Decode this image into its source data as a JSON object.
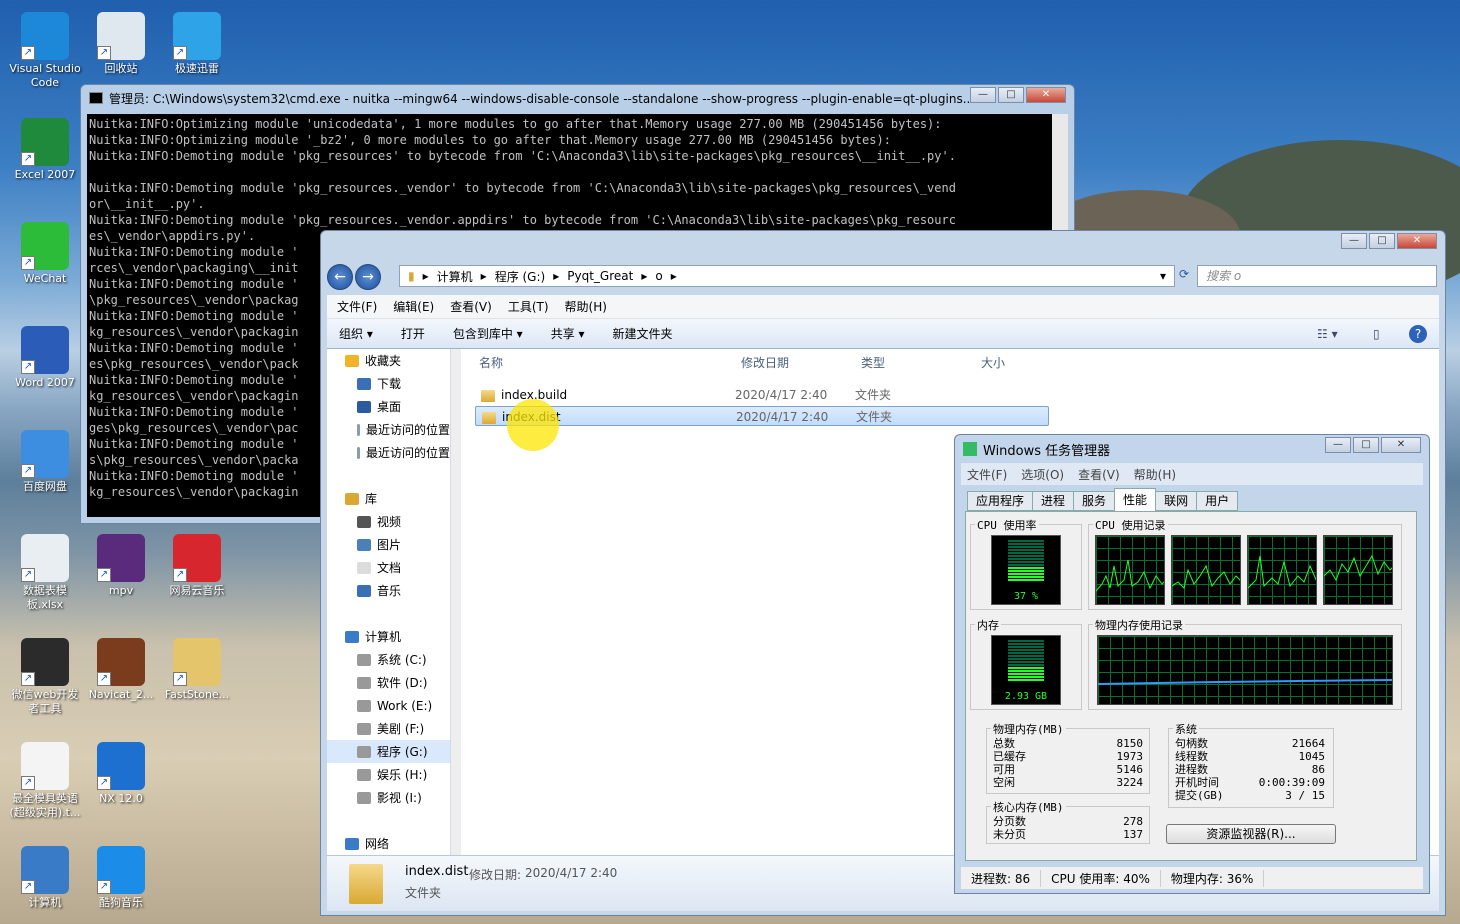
{
  "desktop": {
    "icons": [
      {
        "label": "Visual Studio Code",
        "color": "#1e88d8"
      },
      {
        "label": "回收站",
        "color": "#dfe7ef"
      },
      {
        "label": "极速迅雷",
        "color": "#2fa3e8"
      },
      {
        "label": "Excel 2007",
        "color": "#1f8a3c"
      },
      {
        "label": "WeChat",
        "color": "#2dbb3a"
      },
      {
        "label": "Word 2007",
        "color": "#2a5cb8"
      },
      {
        "label": "百度网盘",
        "color": "#3d8de0"
      },
      {
        "label": "数据表模板.xlsx",
        "color": "#e9eef3"
      },
      {
        "label": "mpv",
        "color": "#5a2b7c"
      },
      {
        "label": "网易云音乐",
        "color": "#d8262e"
      },
      {
        "label": "微信web开发者工具",
        "color": "#2b2b2b"
      },
      {
        "label": "Navicat_2...",
        "color": "#7a3c1c"
      },
      {
        "label": "FastStone...",
        "color": "#e4c56b"
      },
      {
        "label": "最全模具英语(超级实用).t...",
        "color": "#f4f4f4"
      },
      {
        "label": "NX 12.0",
        "color": "#1d6fd0"
      },
      {
        "label": "计算机",
        "color": "#3a7bc8"
      },
      {
        "label": "酷狗音乐",
        "color": "#1b8de8"
      }
    ]
  },
  "cmd": {
    "title": "管理员: C:\\Windows\\system32\\cmd.exe - nuitka  --mingw64 --windows-disable-console --standalone --show-progress --plugin-enable=qt-plugins...",
    "lines": [
      "Nuitka:INFO:Optimizing module 'unicodedata', 1 more modules to go after that.Memory usage 277.00 MB (290451456 bytes):",
      "Nuitka:INFO:Optimizing module '_bz2', 0 more modules to go after that.Memory usage 277.00 MB (290451456 bytes):",
      "Nuitka:INFO:Demoting module 'pkg_resources' to bytecode from 'C:\\Anaconda3\\lib\\site-packages\\pkg_resources\\__init__.py'.",
      "",
      "Nuitka:INFO:Demoting module 'pkg_resources._vendor' to bytecode from 'C:\\Anaconda3\\lib\\site-packages\\pkg_resources\\_vend",
      "or\\__init__.py'.",
      "Nuitka:INFO:Demoting module 'pkg_resources._vendor.appdirs' to bytecode from 'C:\\Anaconda3\\lib\\site-packages\\pkg_resourc",
      "es\\_vendor\\appdirs.py'.",
      "Nuitka:INFO:Demoting module '",
      "rces\\_vendor\\packaging\\__init",
      "Nuitka:INFO:Demoting module '",
      "\\pkg_resources\\_vendor\\packag",
      "Nuitka:INFO:Demoting module '",
      "kg_resources\\_vendor\\packagin",
      "Nuitka:INFO:Demoting module '",
      "es\\pkg_resources\\_vendor\\pack",
      "Nuitka:INFO:Demoting module '",
      "kg_resources\\_vendor\\packagin",
      "Nuitka:INFO:Demoting module '",
      "ges\\pkg_resources\\_vendor\\pac",
      "Nuitka:INFO:Demoting module '",
      "s\\pkg_resources\\_vendor\\packa",
      "Nuitka:INFO:Demoting module '",
      "kg_resources\\_vendor\\packagin"
    ]
  },
  "explorer": {
    "breadcrumb": [
      "计算机",
      "程序 (G:)",
      "Pyqt_Great",
      "o"
    ],
    "search_placeholder": "搜索 o",
    "menu": [
      "文件(F)",
      "编辑(E)",
      "查看(V)",
      "工具(T)",
      "帮助(H)"
    ],
    "toolbar": [
      "组织 ▾",
      "打开",
      "包含到库中 ▾",
      "共享 ▾",
      "新建文件夹"
    ],
    "nav": [
      {
        "label": "收藏夹",
        "indent": 0,
        "color": "#f0b429"
      },
      {
        "label": "下载",
        "indent": 1,
        "color": "#3a6fb5"
      },
      {
        "label": "桌面",
        "indent": 1,
        "color": "#2c5aa0"
      },
      {
        "label": "最近访问的位置",
        "indent": 1,
        "color": "#8a9bb0"
      },
      {
        "label": "最近访问的位置",
        "indent": 1,
        "color": "#8a9bb0"
      },
      {
        "label": "",
        "indent": 0,
        "color": ""
      },
      {
        "label": "库",
        "indent": 0,
        "color": "#d9a933"
      },
      {
        "label": "视频",
        "indent": 1,
        "color": "#555"
      },
      {
        "label": "图片",
        "indent": 1,
        "color": "#4a7fb8"
      },
      {
        "label": "文档",
        "indent": 1,
        "color": "#ddd"
      },
      {
        "label": "音乐",
        "indent": 1,
        "color": "#3a6fb5"
      },
      {
        "label": "",
        "indent": 0,
        "color": ""
      },
      {
        "label": "计算机",
        "indent": 0,
        "color": "#3a7bc8"
      },
      {
        "label": "系统 (C:)",
        "indent": 1,
        "color": "#999"
      },
      {
        "label": "软件 (D:)",
        "indent": 1,
        "color": "#999"
      },
      {
        "label": "Work (E:)",
        "indent": 1,
        "color": "#999"
      },
      {
        "label": "美剧 (F:)",
        "indent": 1,
        "color": "#999"
      },
      {
        "label": "程序 (G:)",
        "indent": 1,
        "color": "#999",
        "selected": true
      },
      {
        "label": "娱乐 (H:)",
        "indent": 1,
        "color": "#999"
      },
      {
        "label": "影视 (I:)",
        "indent": 1,
        "color": "#999"
      },
      {
        "label": "",
        "indent": 0,
        "color": ""
      },
      {
        "label": "网络",
        "indent": 0,
        "color": "#3a7bc8"
      }
    ],
    "columns": [
      "名称",
      "修改日期",
      "类型",
      "大小"
    ],
    "files": [
      {
        "name": "index.build",
        "date": "2020/4/17 2:40",
        "type": "文件夹",
        "selected": false
      },
      {
        "name": "index.dist",
        "date": "2020/4/17 2:40",
        "type": "文件夹",
        "selected": true
      }
    ],
    "details": {
      "name": "index.dist",
      "date_label": "修改日期:",
      "date": "2020/4/17 2:40",
      "type": "文件夹"
    }
  },
  "taskmgr": {
    "title": "Windows 任务管理器",
    "menu": [
      "文件(F)",
      "选项(O)",
      "查看(V)",
      "帮助(H)"
    ],
    "tabs": [
      "应用程序",
      "进程",
      "服务",
      "性能",
      "联网",
      "用户"
    ],
    "active_tab": "性能",
    "cpu_usage_label": "CPU 使用率",
    "cpu_usage": "37 %",
    "cpu_usage_fraction": 0.37,
    "cpu_history_label": "CPU 使用记录",
    "mem_label": "内存",
    "mem_value": "2.93 GB",
    "mem_fraction": 0.36,
    "mem_history_label": "物理内存使用记录",
    "physical": {
      "title": "物理内存(MB)",
      "rows": [
        [
          "总数",
          "8150"
        ],
        [
          "已缓存",
          "1973"
        ],
        [
          "可用",
          "5146"
        ],
        [
          "空闲",
          "3224"
        ]
      ]
    },
    "kernel": {
      "title": "核心内存(MB)",
      "rows": [
        [
          "分页数",
          "278"
        ],
        [
          "未分页",
          "137"
        ]
      ]
    },
    "system": {
      "title": "系统",
      "rows": [
        [
          "句柄数",
          "21664"
        ],
        [
          "线程数",
          "1045"
        ],
        [
          "进程数",
          "86"
        ],
        [
          "开机时间",
          "0:00:39:09"
        ],
        [
          "提交(GB)",
          "3 / 15"
        ]
      ]
    },
    "resmon_button": "资源监视器(R)...",
    "status": [
      "进程数: 86",
      "CPU 使用率: 40%",
      "物理内存: 36%"
    ]
  }
}
